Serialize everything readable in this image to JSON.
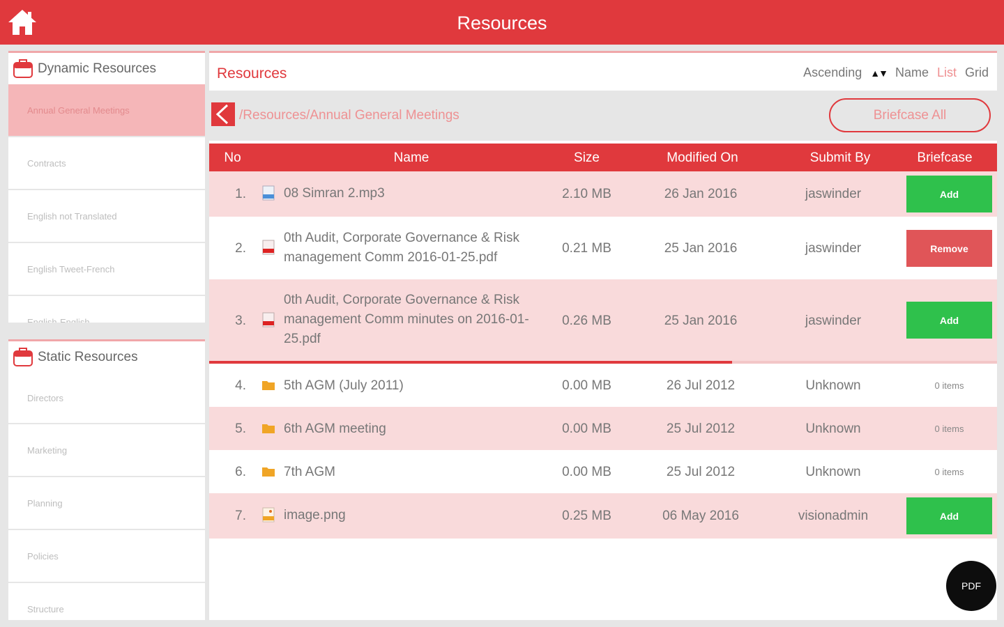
{
  "app": {
    "title": "Resources"
  },
  "sidebar": {
    "dynamic": {
      "header": "Dynamic Resources",
      "items": [
        "Annual General Meetings",
        "Contracts",
        "English not Translated",
        "English Tweet-French",
        "English-English"
      ]
    },
    "static": {
      "header": "Static Resources",
      "items": [
        "Directors",
        "Marketing",
        "Planning",
        "Policies",
        "Structure"
      ]
    }
  },
  "main": {
    "title": "Resources",
    "sort": {
      "order": "Ascending",
      "field": "Name",
      "view_list": "List",
      "view_grid": "Grid"
    },
    "path": "/Resources/Annual General Meetings",
    "briefcase_all": "Briefcase All",
    "columns": [
      "No",
      "Name",
      "Size",
      "Modified On",
      "Submit By",
      "Briefcase"
    ],
    "rows": [
      {
        "no": "1.",
        "icon": "audio-file-icon",
        "name": "08 Simran 2.mp3",
        "size": "2.10 MB",
        "modified": "26 Jan 2016",
        "by": "jaswinder",
        "action": "Add"
      },
      {
        "no": "2.",
        "icon": "pdf-file-icon",
        "name": "0th Audit, Corporate Governance & Risk management Comm 2016-01-25.pdf",
        "size": "0.21 MB",
        "modified": "25 Jan 2016",
        "by": "jaswinder",
        "action": "Remove"
      },
      {
        "no": "3.",
        "icon": "pdf-file-icon",
        "name": "0th Audit, Corporate Governance & Risk management Comm minutes on 2016-01-25.pdf",
        "size": "0.26 MB",
        "modified": "25 Jan 2016",
        "by": "jaswinder",
        "action": "Add"
      },
      {
        "no": "4.",
        "icon": "folder-icon",
        "name": "5th AGM (July 2011)",
        "size": "0.00 MB",
        "modified": "26 Jul 2012",
        "by": "Unknown",
        "action": "0 items"
      },
      {
        "no": "5.",
        "icon": "folder-icon",
        "name": "6th AGM meeting",
        "size": "0.00 MB",
        "modified": "25 Jul 2012",
        "by": "Unknown",
        "action": "0 items"
      },
      {
        "no": "6.",
        "icon": "folder-icon",
        "name": "7th AGM",
        "size": "0.00 MB",
        "modified": "25 Jul 2012",
        "by": "Unknown",
        "action": "0 items"
      },
      {
        "no": "7.",
        "icon": "image-file-icon",
        "name": "image.png",
        "size": "0.25 MB",
        "modified": "06 May 2016",
        "by": "visionadmin",
        "action": "Add"
      }
    ]
  },
  "fab": {
    "label": "PDF"
  },
  "colors": {
    "brand": "#e0393d",
    "add": "#2fc14c",
    "remove": "#e05558",
    "row_highlight": "#f9dadb"
  }
}
